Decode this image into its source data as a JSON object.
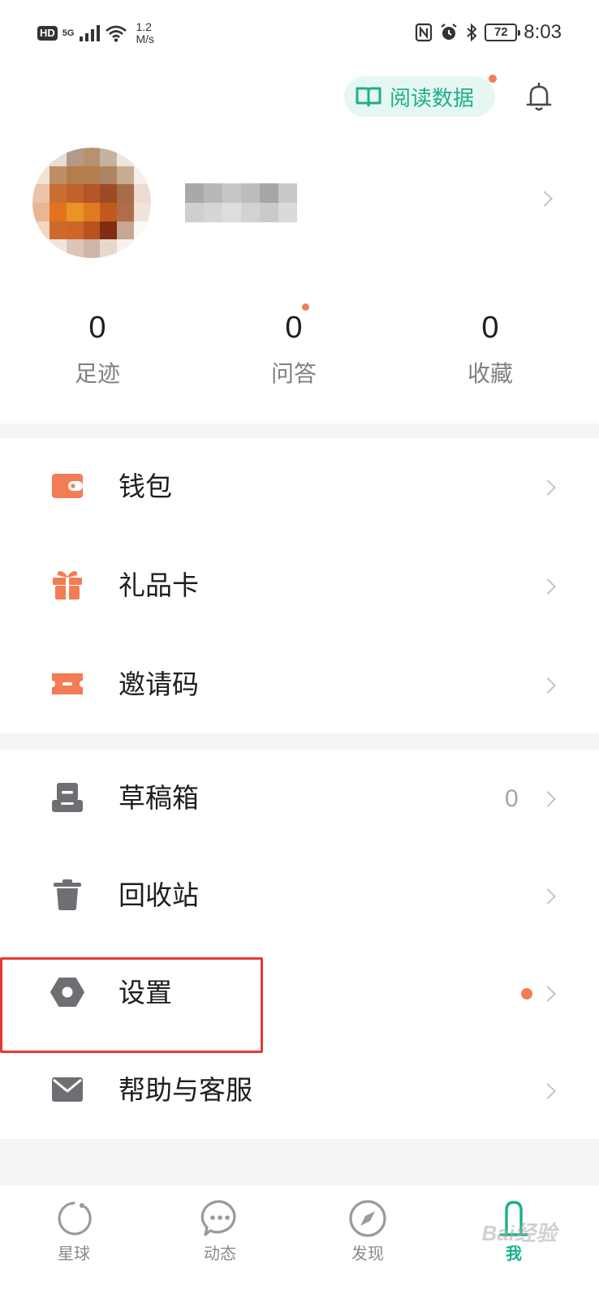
{
  "status_bar": {
    "hd": "HD",
    "network": "5G",
    "speed_value": "1.2",
    "speed_unit": "M/s",
    "battery": "72",
    "time": "8:03"
  },
  "header": {
    "read_data_label": "阅读数据"
  },
  "stats": [
    {
      "value": "0",
      "label": "足迹"
    },
    {
      "value": "0",
      "label": "问答"
    },
    {
      "value": "0",
      "label": "收藏"
    }
  ],
  "menu_group_1": [
    {
      "label": "钱包",
      "icon": "wallet-icon"
    },
    {
      "label": "礼品卡",
      "icon": "gift-icon"
    },
    {
      "label": "邀请码",
      "icon": "ticket-icon"
    }
  ],
  "menu_group_2": [
    {
      "label": "草稿箱",
      "icon": "drafts-icon",
      "count": "0"
    },
    {
      "label": "回收站",
      "icon": "trash-icon"
    },
    {
      "label": "设置",
      "icon": "settings-icon"
    },
    {
      "label": "帮助与客服",
      "icon": "mail-icon"
    }
  ],
  "tabs": [
    {
      "label": "星球",
      "icon": "planet-icon"
    },
    {
      "label": "动态",
      "icon": "chat-bubble-icon"
    },
    {
      "label": "发现",
      "icon": "compass-icon"
    },
    {
      "label": "我",
      "icon": "person-icon",
      "active": true
    }
  ],
  "watermark": "Bai经验",
  "colors": {
    "accent": "#16b28a",
    "orange": "#f47c55",
    "gray_icon": "#6f6f73",
    "highlight": "#e53935"
  }
}
